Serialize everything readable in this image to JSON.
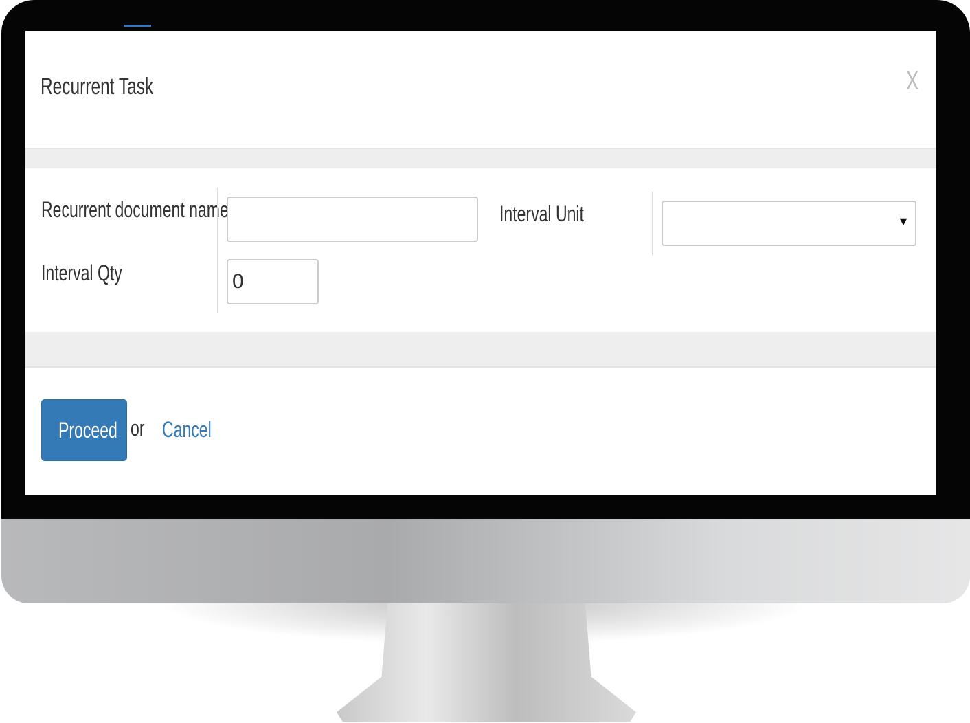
{
  "dialog": {
    "title": "Recurrent Task",
    "close_label": "X",
    "fields": {
      "doc_name_label": "Recurrent document name",
      "doc_name_value": "",
      "interval_unit_label": "Interval Unit",
      "interval_unit_value": "",
      "interval_qty_label": "Interval Qty",
      "interval_qty_value": "0"
    },
    "footer": {
      "proceed_label": "Proceed",
      "or_text": "or",
      "cancel_label": "Cancel"
    }
  },
  "colors": {
    "primary": "#337ab7"
  }
}
